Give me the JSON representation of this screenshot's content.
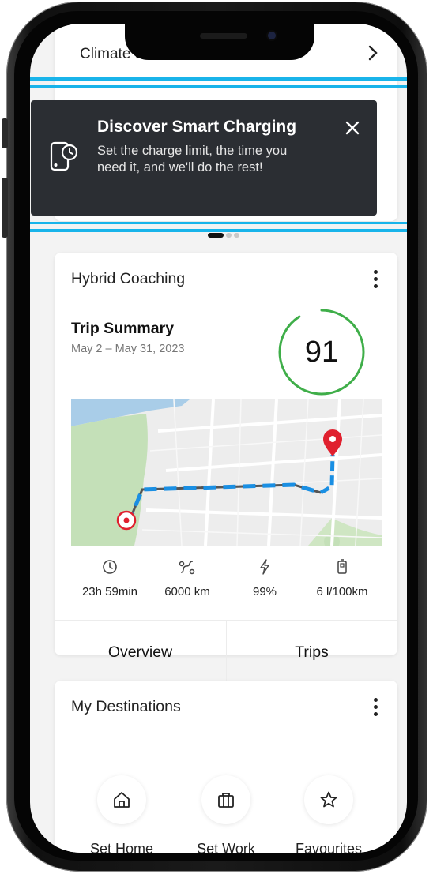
{
  "climate": {
    "label": "Climate Schedule"
  },
  "banner": {
    "title": "Discover Smart Charging",
    "text": "Set the charge limit, the time you need it, and we'll do the rest!"
  },
  "carousel": {
    "total": 3,
    "active": 1
  },
  "hybrid_coaching": {
    "title": "Hybrid Coaching",
    "trip_title": "Trip Summary",
    "date_range": "May 2 – May 31, 2023",
    "score": "91",
    "stats": [
      {
        "icon": "clock-icon",
        "value": "23h 59min"
      },
      {
        "icon": "route-icon",
        "value": "6000 km"
      },
      {
        "icon": "lightning-icon",
        "value": "99%"
      },
      {
        "icon": "fuel-icon",
        "value": "6 l/100km"
      }
    ],
    "tabs": {
      "overview": "Overview",
      "trips": "Trips"
    }
  },
  "destinations": {
    "title": "My Destinations",
    "items": [
      {
        "icon": "home-icon",
        "label": "Set Home"
      },
      {
        "icon": "briefcase-icon",
        "label": "Set Work"
      },
      {
        "icon": "star-icon",
        "label": "Favourites"
      }
    ]
  },
  "colors": {
    "banner_bg": "#2b2e33",
    "highlight": "#19b4ea",
    "score_ring": "#3fae49",
    "route": "#1a8fe3",
    "pin": "#e0202e"
  }
}
